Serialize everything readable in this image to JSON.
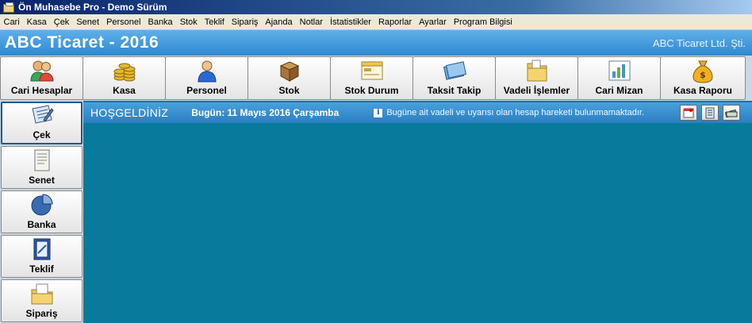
{
  "window": {
    "title": "Ön Muhasebe Pro - Demo Sürüm"
  },
  "menu": [
    "Cari",
    "Kasa",
    "Çek",
    "Senet",
    "Personel",
    "Banka",
    "Stok",
    "Teklif",
    "Sipariş",
    "Ajanda",
    "Notlar",
    "İstatistikler",
    "Raporlar",
    "Ayarlar",
    "Program Bilgisi"
  ],
  "header": {
    "title": "ABC Ticaret - 2016",
    "company": "ABC Ticaret Ltd. Şti."
  },
  "toolbar": [
    {
      "label": "Cari Hesaplar",
      "icon": "users-icon"
    },
    {
      "label": "Kasa",
      "icon": "coins-icon"
    },
    {
      "label": "Personel",
      "icon": "person-icon"
    },
    {
      "label": "Stok",
      "icon": "box-icon"
    },
    {
      "label": "Stok Durum",
      "icon": "window-icon"
    },
    {
      "label": "Taksit Takip",
      "icon": "card-icon"
    },
    {
      "label": "Vadeli İşlemler",
      "icon": "folder-icon"
    },
    {
      "label": "Cari Mizan",
      "icon": "chart-icon"
    },
    {
      "label": "Kasa Raporu",
      "icon": "money-bag-icon"
    }
  ],
  "sidebar": [
    {
      "label": "Çek",
      "icon": "check-book-icon"
    },
    {
      "label": "Senet",
      "icon": "document-icon"
    },
    {
      "label": "Banka",
      "icon": "pie-icon"
    },
    {
      "label": "Teklif",
      "icon": "offer-icon"
    },
    {
      "label": "Sipariş",
      "icon": "order-icon"
    }
  ],
  "welcome": {
    "greeting": "HOŞGELDİNİZ",
    "today": "Bugün: 11 Mayıs 2016 Çarşamba",
    "notice": "Bugüne ait vadeli ve uyarısı olan hesap hareketi bulunmamaktadır."
  },
  "colors": {
    "header": "#2f88cf",
    "workspace": "#087a9b",
    "menubar": "#ece9d8"
  }
}
